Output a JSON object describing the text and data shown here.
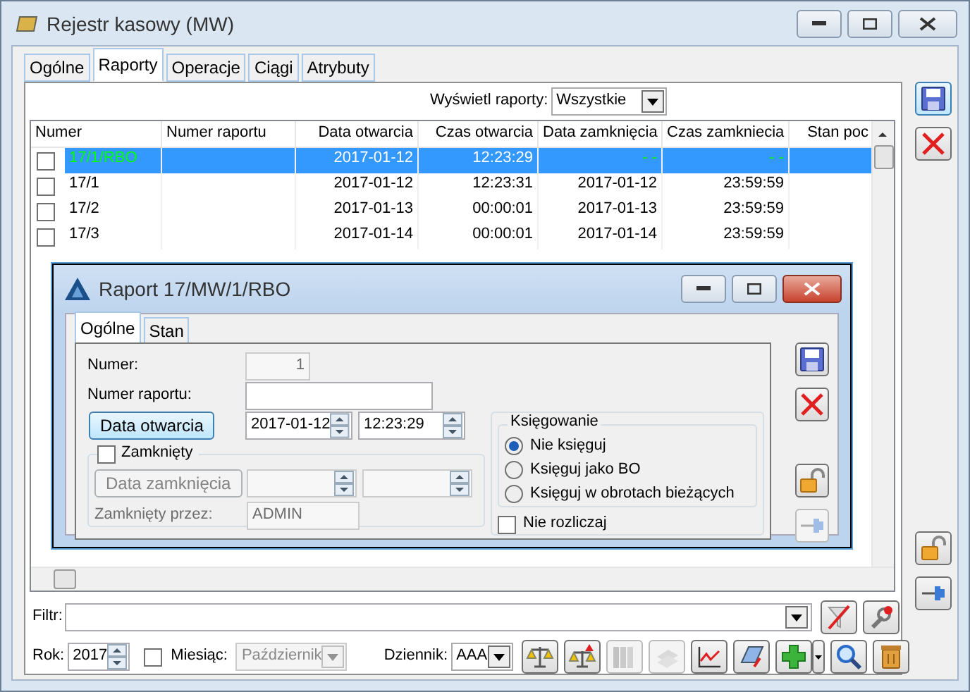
{
  "window": {
    "title": "Rejestr kasowy (MW)"
  },
  "tabs": [
    {
      "label": "Ogólne",
      "selected": false
    },
    {
      "label": "Raporty",
      "selected": true
    },
    {
      "label": "Operacje",
      "selected": false
    },
    {
      "label": "Ciągi",
      "selected": false
    },
    {
      "label": "Atrybuty",
      "selected": false
    }
  ],
  "report_filter": {
    "label": "Wyświetl raporty:",
    "value": "Wszystkie"
  },
  "table": {
    "columns": [
      "Numer",
      "Numer raportu",
      "Data otwarcia",
      "Czas otwarcia",
      "Data zamknięcia",
      "Czas zamkniecia",
      "Stan poc"
    ],
    "rows": [
      {
        "checked": false,
        "selected": true,
        "color": "#00ff00",
        "numer": "17/1/RBO",
        "data_otwarcia": "2017-01-12",
        "czas_otwarcia": "12:23:29",
        "data_zamkniecia": "- -",
        "czas_zamkniecia": "- -"
      },
      {
        "checked": false,
        "selected": false,
        "color": "#000000",
        "numer": "17/1",
        "data_otwarcia": "2017-01-12",
        "czas_otwarcia": "12:23:31",
        "data_zamkniecia": "2017-01-12",
        "czas_zamkniecia": "23:59:59"
      },
      {
        "checked": false,
        "selected": false,
        "color": "#000000",
        "numer": "17/2",
        "data_otwarcia": "2017-01-13",
        "czas_otwarcia": "00:00:01",
        "data_zamkniecia": "2017-01-13",
        "czas_zamkniecia": "23:59:59"
      },
      {
        "checked": false,
        "selected": false,
        "color": "#000000",
        "numer": "17/3",
        "data_otwarcia": "2017-01-14",
        "czas_otwarcia": "00:00:01",
        "data_zamkniecia": "2017-01-14",
        "czas_zamkniecia": "23:59:59"
      }
    ]
  },
  "dialog": {
    "title": "Raport 17/MW/1/RBO",
    "tabs": [
      {
        "label": "Ogólne",
        "selected": true
      },
      {
        "label": "Stan",
        "selected": false
      }
    ],
    "numer": {
      "label": "Numer:",
      "value": "1",
      "disabled": true
    },
    "numer_raportu": {
      "label": "Numer raportu:"
    },
    "open_button": {
      "label": "Data otwarcia"
    },
    "open_date": "2017-01-12",
    "open_time": "12:23:29",
    "closed": {
      "label": "Zamknięty",
      "checked": false
    },
    "close_button": {
      "label": "Data zamknięcia",
      "disabled": true
    },
    "closed_by": {
      "label": "Zamknięty przez:",
      "value": "ADMIN",
      "disabled": true
    },
    "posting": {
      "title": "Księgowanie",
      "options": [
        {
          "label": "Nie księguj",
          "selected": true
        },
        {
          "label": "Księguj jako BO",
          "selected": false
        },
        {
          "label": "Księguj w obrotach bieżących",
          "selected": false
        }
      ]
    },
    "no_settle": {
      "label": "Nie rozliczaj",
      "checked": false
    },
    "toolbar": [
      {
        "kind": "save",
        "disabled": false
      },
      {
        "kind": "cancel",
        "disabled": false
      },
      {
        "kind": "lock",
        "disabled": false
      },
      {
        "kind": "pin",
        "disabled": true
      }
    ]
  },
  "filter": {
    "label": "Filtr:"
  },
  "year": {
    "label": "Rok:",
    "value": "2017"
  },
  "month": {
    "label": "Miesiąc:",
    "checked": false,
    "value": "Październik",
    "disabled": true
  },
  "journal": {
    "label": "Dziennik:",
    "value": "AAA"
  },
  "actions": [
    {
      "kind": "scales",
      "disabled": false
    },
    {
      "kind": "scales-up",
      "disabled": false
    },
    {
      "kind": "binders",
      "disabled": true
    },
    {
      "kind": "stack",
      "disabled": true
    },
    {
      "kind": "chart",
      "disabled": false
    },
    {
      "kind": "card",
      "disabled": false
    },
    {
      "kind": "add",
      "disabled": false
    },
    {
      "kind": "search",
      "disabled": false
    },
    {
      "kind": "trash",
      "disabled": false
    }
  ],
  "side_toolbar": [
    {
      "kind": "save",
      "disabled": false
    },
    {
      "kind": "cancel",
      "disabled": false
    },
    {
      "kind": "lock",
      "disabled": false
    },
    {
      "kind": "pin",
      "disabled": false
    }
  ]
}
